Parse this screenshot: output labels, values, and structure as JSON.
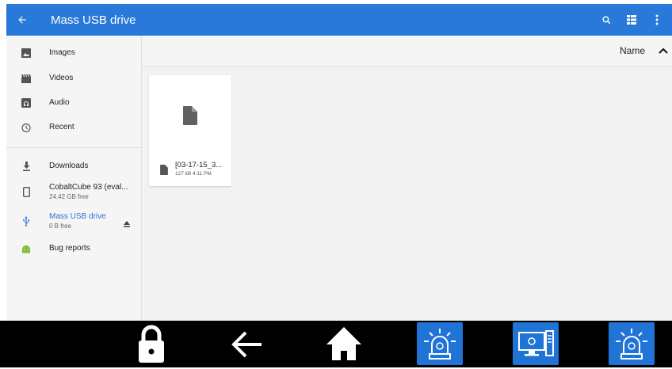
{
  "appbar": {
    "title": "Mass USB drive",
    "back_icon": "arrow-back-icon",
    "search_icon": "search-icon",
    "grid_icon": "view-grid-icon",
    "more_icon": "more-vert-icon",
    "color": "#2879d9"
  },
  "drawer": {
    "items": [
      {
        "label": "Images",
        "icon": "image-icon"
      },
      {
        "label": "Videos",
        "icon": "movie-icon"
      },
      {
        "label": "Audio",
        "icon": "audio-icon"
      },
      {
        "label": "Recent",
        "icon": "clock-icon"
      },
      {
        "label": "Downloads",
        "icon": "download-icon"
      },
      {
        "label": "CobaltCube 93 (eval...",
        "sub": "24.42 GB free",
        "icon": "phone-icon"
      },
      {
        "label": "Mass USB drive",
        "sub": "0 B free",
        "icon": "usb-icon",
        "active": true,
        "action_icon": "eject-icon"
      },
      {
        "label": "Bug reports",
        "icon": "android-icon"
      }
    ]
  },
  "sort": {
    "label": "Name",
    "icon": "chevron-up-icon"
  },
  "files": [
    {
      "name": "[03-17-15_3...",
      "meta": "127 kB 4:11 PM",
      "icon": "file-icon"
    }
  ],
  "dock": {
    "items": [
      "lock-icon",
      "arrow-left-icon",
      "home-icon",
      "alarm-beacon-icon",
      "computer-monitor-icon",
      "alarm-beacon-icon"
    ],
    "tile_color": "#1f74d6"
  }
}
